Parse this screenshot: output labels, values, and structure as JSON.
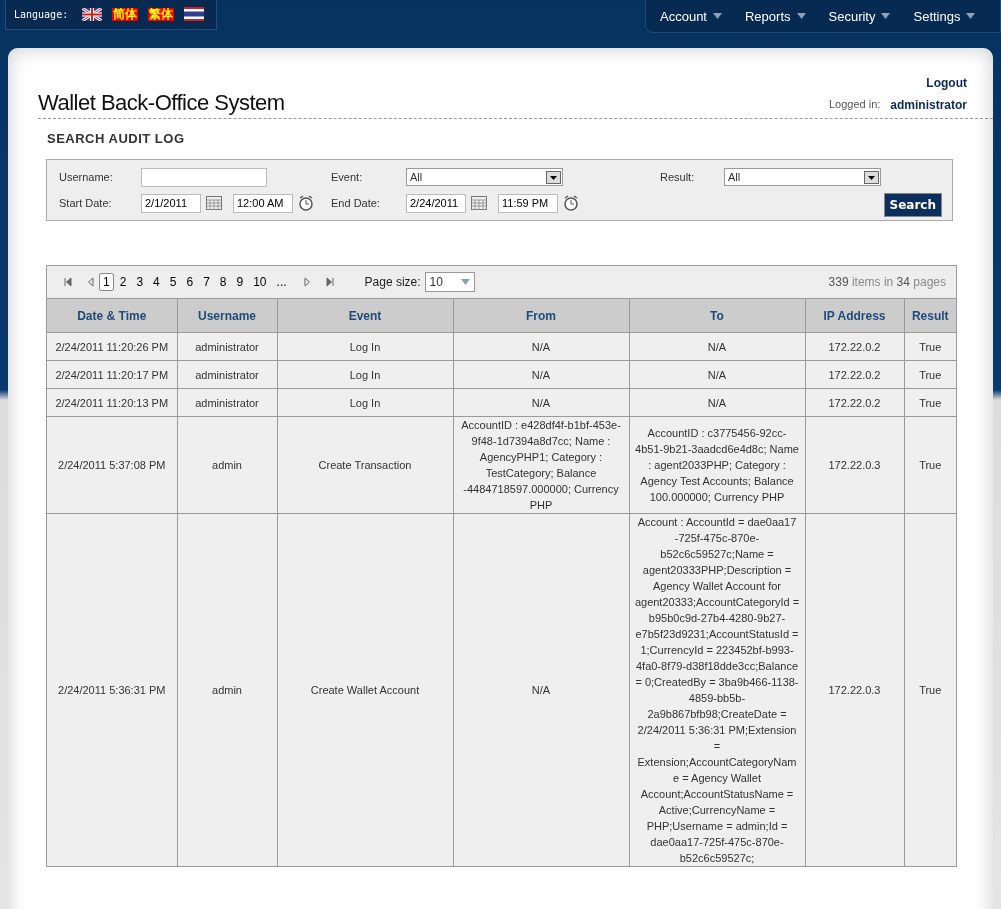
{
  "language": {
    "label": "Language:",
    "options": [
      {
        "kind": "uk-flag"
      },
      {
        "kind": "text",
        "label": "简体"
      },
      {
        "kind": "text",
        "label": "繁体"
      },
      {
        "kind": "thai-flag"
      }
    ]
  },
  "nav": [
    "Account",
    "Reports",
    "Security",
    "Settings"
  ],
  "header": {
    "logout": "Logout",
    "logged_in_label": "Logged in:",
    "user": "administrator",
    "title": "Wallet Back-Office System"
  },
  "search": {
    "heading": "SEARCH AUDIT LOG",
    "username": {
      "label": "Username:"
    },
    "event": {
      "label": "Event:",
      "value": "All"
    },
    "result": {
      "label": "Result:",
      "value": "All"
    },
    "start_date": {
      "label": "Start Date:",
      "date": "2/1/2011",
      "time": "12:00 AM"
    },
    "end_date": {
      "label": "End Date:",
      "date": "2/24/2011",
      "time": "11:59 PM"
    },
    "button": "Search"
  },
  "pager": {
    "pages": [
      {
        "label": "1",
        "selected": true
      },
      {
        "label": "2",
        "selected": false
      },
      {
        "label": "3",
        "selected": false
      },
      {
        "label": "4",
        "selected": false
      },
      {
        "label": "5",
        "selected": false
      },
      {
        "label": "6",
        "selected": false
      },
      {
        "label": "7",
        "selected": false
      },
      {
        "label": "8",
        "selected": false
      },
      {
        "label": "9",
        "selected": false
      },
      {
        "label": "10",
        "selected": false
      },
      {
        "label": "...",
        "selected": false
      }
    ],
    "page_size_label": "Page size:",
    "page_size": "10",
    "summary": "**339** items in **34** pages"
  },
  "table": {
    "columns": [
      "Date & Time",
      "Username",
      "Event",
      "From",
      "To",
      "IP Address",
      "Result"
    ],
    "rows": [
      [
        "2/24/2011 11:20:26 PM",
        "administrator",
        "Log In",
        "N/A",
        "N/A",
        "172.22.0.2",
        "True"
      ],
      [
        "2/24/2011 11:20:17 PM",
        "administrator",
        "Log In",
        "N/A",
        "N/A",
        "172.22.0.2",
        "True"
      ],
      [
        "2/24/2011 11:20:13 PM",
        "administrator",
        "Log In",
        "N/A",
        "N/A",
        "172.22.0.2",
        "True"
      ],
      [
        "2/24/2011 5:37:08 PM",
        "admin",
        "Create Transaction",
        "AccountID : e428df4f-b1bf-453e-9f48-1d7394a8d7cc; Name : AgencyPHP1; Category : TestCategory; Balance -4484718597.000000; Currency PHP",
        "AccountID : c3775456-92cc-4b51-9b21-3aadcd6e4d8c; Name : agent2033PHP; Category : Agency Test Accounts; Balance 100.000000; Currency PHP",
        "172.22.0.3",
        "True"
      ],
      [
        "2/24/2011 5:36:31 PM",
        "admin",
        "Create Wallet Account",
        "N/A",
        "Account : AccountId = dae0aa17 -725f-475c-870e-b52c6c59527c;Name = agent20333PHP;Description = Agency Wallet Account for agent20333;AccountCategoryId = b95b0c9d-27b4-4280-9b27-e7b5f23d9231;AccountStatusId = 1;CurrencyId = 223452bf-b993-4fa0-8f79-d38f18dde3cc;Balance = 0;CreatedBy = 3ba9b466-1138-4859-bb5b-2a9b867bfb98;CreateDate = 2/24/2011 5:36:31 PM;Extension = Extension;AccountCategoryName = Agency Wallet Account;AccountStatusName = Active;CurrencyName = PHP;Username = admin;Id = dae0aa17-725f-475c-870e-b52c6c59527c;",
        "172.22.0.3",
        "True"
      ]
    ]
  }
}
